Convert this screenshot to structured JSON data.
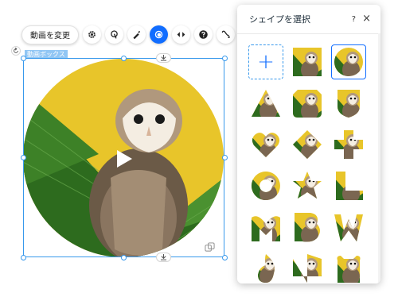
{
  "toolbar": {
    "change_video_label": "動画を変更",
    "icons": [
      "gear-icon",
      "animation-icon",
      "design-brush-icon",
      "shape-mask-icon",
      "navigate-icon",
      "help-icon",
      "connect-icon"
    ]
  },
  "element": {
    "label": "動画ボックス"
  },
  "panel": {
    "title": "シェイプを選択",
    "help": "?",
    "close": "×",
    "add_symbol": "+",
    "shapes": [
      "add",
      "square",
      "circle",
      "triangle",
      "rounded-notched",
      "shield",
      "heart",
      "diamond",
      "cross",
      "ring",
      "star",
      "l-shape",
      "blob-m",
      "blob-b",
      "blob-w",
      "blob-flame",
      "leaf",
      "blob-dog"
    ]
  },
  "colors": {
    "accent": "#116dff",
    "selection": "#3899ec",
    "background_yellow": "#e8c52a",
    "palm_green": "#2d6b1e"
  }
}
